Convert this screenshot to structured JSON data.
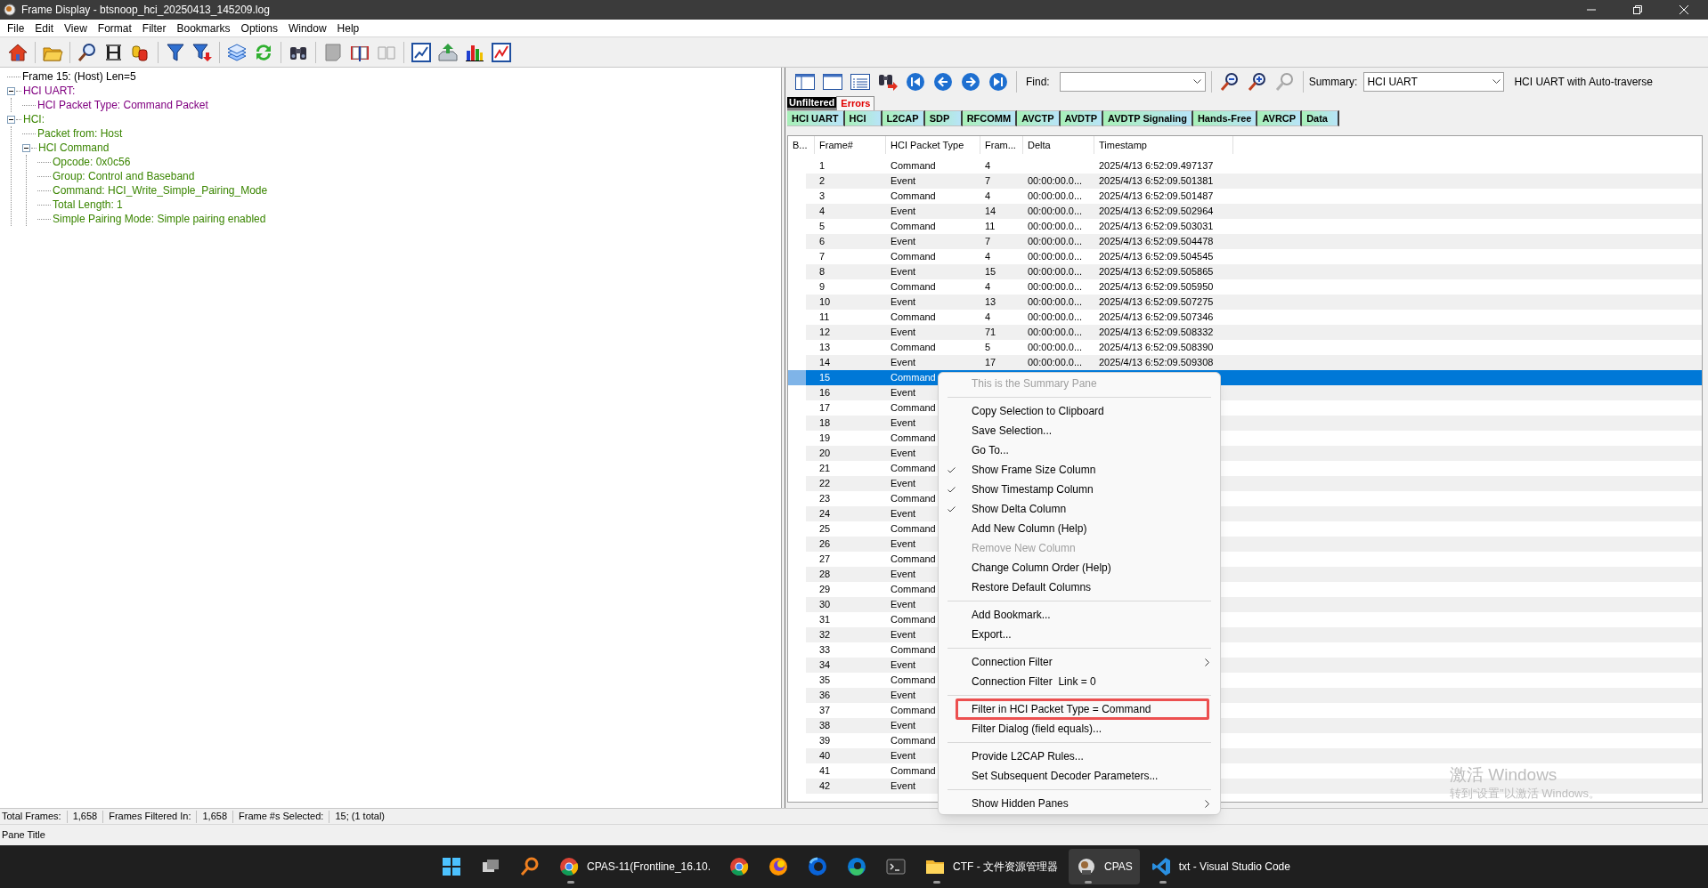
{
  "window": {
    "title": "Frame Display - btsnoop_hci_20250413_145209.log"
  },
  "menu": [
    "File",
    "Edit",
    "View",
    "Format",
    "Filter",
    "Bookmarks",
    "Options",
    "Window",
    "Help"
  ],
  "decode_tree": [
    {
      "label": "Frame 15: (Host) Len=5",
      "color": "#000000"
    },
    {
      "label": "HCI UART:",
      "color": "#800080",
      "expanded": true,
      "children": [
        {
          "label": "HCI Packet Type: Command Packet",
          "color": "#800080"
        }
      ]
    },
    {
      "label": "HCI:",
      "color": "#3a8500",
      "expanded": true,
      "children": [
        {
          "label": "Packet from: Host",
          "color": "#3a8500"
        },
        {
          "label": "HCI Command",
          "color": "#3a8500",
          "expanded": true,
          "children": [
            {
              "label": "Opcode: 0x0c56",
              "color": "#3a8500"
            },
            {
              "label": "Group: Control and Baseband",
              "color": "#3a8500"
            },
            {
              "label": "Command: HCI_Write_Simple_Pairing_Mode",
              "color": "#3a8500"
            },
            {
              "label": "Total Length: 1",
              "color": "#3a8500"
            },
            {
              "label": "Simple Pairing Mode: Simple pairing enabled",
              "color": "#3a8500"
            }
          ]
        }
      ]
    }
  ],
  "summary_toolbar": {
    "find_label": "Find:",
    "summary_label": "Summary:",
    "summary_value": "HCI UART",
    "mode": "HCI UART with Auto-traverse"
  },
  "filter_tabs": [
    {
      "label": "Unfiltered",
      "selected": true
    },
    {
      "label": "Errors",
      "selected": false
    }
  ],
  "protocol_tabs": [
    {
      "label": "HCI UART",
      "selected": false
    },
    {
      "label": "HCI",
      "selected": false
    },
    {
      "label": "L2CAP",
      "selected": false
    },
    {
      "label": "SDP",
      "selected": false
    },
    {
      "label": "RFCOMM",
      "selected": false
    },
    {
      "label": "AVCTP",
      "selected": false
    },
    {
      "label": "AVDTP",
      "selected": false
    },
    {
      "label": "AVDTP Signaling",
      "selected": false
    },
    {
      "label": "Hands-Free",
      "selected": false
    },
    {
      "label": "AVRCP",
      "selected": false
    },
    {
      "label": "Data",
      "selected": false
    }
  ],
  "table": {
    "columns": [
      "B...",
      "Frame#",
      "HCI Packet Type",
      "Fram...",
      "Delta",
      "Timestamp"
    ],
    "rows": [
      {
        "frame": "1",
        "type": "Command",
        "size": "4",
        "timestamp": "2025/4/13 6:52:09.497137",
        "selected": false
      },
      {
        "frame": "2",
        "type": "Event",
        "size": "7",
        "delta": "00:00:00.0...",
        "timestamp": "2025/4/13 6:52:09.501381",
        "selected": false
      },
      {
        "frame": "3",
        "type": "Command",
        "size": "4",
        "delta": "00:00:00.0...",
        "timestamp": "2025/4/13 6:52:09.501487",
        "selected": false
      },
      {
        "frame": "4",
        "type": "Event",
        "size": "14",
        "delta": "00:00:00.0...",
        "timestamp": "2025/4/13 6:52:09.502964",
        "selected": false
      },
      {
        "frame": "5",
        "type": "Command",
        "size": "11",
        "delta": "00:00:00.0...",
        "timestamp": "2025/4/13 6:52:09.503031",
        "selected": false
      },
      {
        "frame": "6",
        "type": "Event",
        "size": "7",
        "delta": "00:00:00.0...",
        "timestamp": "2025/4/13 6:52:09.504478",
        "selected": false
      },
      {
        "frame": "7",
        "type": "Command",
        "size": "4",
        "delta": "00:00:00.0...",
        "timestamp": "2025/4/13 6:52:09.504545",
        "selected": false
      },
      {
        "frame": "8",
        "type": "Event",
        "size": "15",
        "delta": "00:00:00.0...",
        "timestamp": "2025/4/13 6:52:09.505865",
        "selected": false
      },
      {
        "frame": "9",
        "type": "Command",
        "size": "4",
        "delta": "00:00:00.0...",
        "timestamp": "2025/4/13 6:52:09.505950",
        "selected": false
      },
      {
        "frame": "10",
        "type": "Event",
        "size": "13",
        "delta": "00:00:00.0...",
        "timestamp": "2025/4/13 6:52:09.507275",
        "selected": false
      },
      {
        "frame": "11",
        "type": "Command",
        "size": "4",
        "delta": "00:00:00.0...",
        "timestamp": "2025/4/13 6:52:09.507346",
        "selected": false
      },
      {
        "frame": "12",
        "type": "Event",
        "size": "71",
        "delta": "00:00:00.0...",
        "timestamp": "2025/4/13 6:52:09.508332",
        "selected": false
      },
      {
        "frame": "13",
        "type": "Command",
        "size": "5",
        "delta": "00:00:00.0...",
        "timestamp": "2025/4/13 6:52:09.508390",
        "selected": false
      },
      {
        "frame": "14",
        "type": "Event",
        "size": "17",
        "delta": "00:00:00.0...",
        "timestamp": "2025/4/13 6:52:09.509308",
        "selected": false
      },
      {
        "frame": "15",
        "type": "Command",
        "selected": true
      },
      {
        "frame": "16",
        "type": "Event",
        "selected": false
      },
      {
        "frame": "17",
        "type": "Command",
        "selected": false
      },
      {
        "frame": "18",
        "type": "Event",
        "selected": false
      },
      {
        "frame": "19",
        "type": "Command",
        "selected": false
      },
      {
        "frame": "20",
        "type": "Event",
        "selected": false
      },
      {
        "frame": "21",
        "type": "Command",
        "selected": false
      },
      {
        "frame": "22",
        "type": "Event",
        "selected": false
      },
      {
        "frame": "23",
        "type": "Command",
        "selected": false
      },
      {
        "frame": "24",
        "type": "Event",
        "selected": false
      },
      {
        "frame": "25",
        "type": "Command",
        "selected": false
      },
      {
        "frame": "26",
        "type": "Event",
        "selected": false
      },
      {
        "frame": "27",
        "type": "Command",
        "selected": false
      },
      {
        "frame": "28",
        "type": "Event",
        "selected": false
      },
      {
        "frame": "29",
        "type": "Command",
        "selected": false
      },
      {
        "frame": "30",
        "type": "Event",
        "selected": false
      },
      {
        "frame": "31",
        "type": "Command",
        "selected": false
      },
      {
        "frame": "32",
        "type": "Event",
        "selected": false
      },
      {
        "frame": "33",
        "type": "Command",
        "selected": false
      },
      {
        "frame": "34",
        "type": "Event",
        "selected": false
      },
      {
        "frame": "35",
        "type": "Command",
        "selected": false
      },
      {
        "frame": "36",
        "type": "Event",
        "selected": false
      },
      {
        "frame": "37",
        "type": "Command",
        "selected": false
      },
      {
        "frame": "38",
        "type": "Event",
        "selected": false
      },
      {
        "frame": "39",
        "type": "Command",
        "selected": false
      },
      {
        "frame": "40",
        "type": "Event",
        "selected": false
      },
      {
        "frame": "41",
        "type": "Command",
        "selected": false
      },
      {
        "frame": "42",
        "type": "Event",
        "selected": false
      }
    ]
  },
  "context_menu": {
    "items": [
      {
        "kind": "item",
        "label": "This is the Summary Pane",
        "disabled": true,
        "checked": false
      },
      {
        "kind": "separator"
      },
      {
        "kind": "item",
        "label": "Copy Selection to Clipboard",
        "disabled": false,
        "checked": false
      },
      {
        "kind": "item",
        "label": "Save Selection...",
        "disabled": false,
        "checked": false
      },
      {
        "kind": "item",
        "label": "Go To...",
        "disabled": false,
        "checked": false
      },
      {
        "kind": "item",
        "label": "Show Frame Size Column",
        "disabled": false,
        "checked": true
      },
      {
        "kind": "item",
        "label": "Show Timestamp Column",
        "disabled": false,
        "checked": true
      },
      {
        "kind": "item",
        "label": "Show Delta Column",
        "disabled": false,
        "checked": true
      },
      {
        "kind": "item",
        "label": "Add New Column (Help)",
        "disabled": false,
        "checked": false
      },
      {
        "kind": "item",
        "label": "Remove New Column",
        "disabled": true,
        "checked": false
      },
      {
        "kind": "item",
        "label": "Change Column Order (Help)",
        "disabled": false,
        "checked": false
      },
      {
        "kind": "item",
        "label": "Restore Default Columns",
        "disabled": false,
        "checked": false
      },
      {
        "kind": "separator"
      },
      {
        "kind": "item",
        "label": "Add Bookmark...",
        "disabled": false,
        "checked": false
      },
      {
        "kind": "item",
        "label": "Export...",
        "disabled": false,
        "checked": false
      },
      {
        "kind": "separator"
      },
      {
        "kind": "item",
        "label": "Connection Filter",
        "disabled": false,
        "checked": false,
        "submenu": true
      },
      {
        "kind": "item",
        "label": "Connection Filter  Link = 0",
        "disabled": false,
        "checked": false
      },
      {
        "kind": "separator"
      },
      {
        "kind": "item",
        "label": "Filter in HCI Packet Type = Command",
        "disabled": false,
        "checked": false,
        "annotated": true
      },
      {
        "kind": "item",
        "label": "Filter Dialog (field equals)...",
        "disabled": false,
        "checked": false
      },
      {
        "kind": "separator"
      },
      {
        "kind": "item",
        "label": "Provide L2CAP Rules...",
        "disabled": false,
        "checked": false
      },
      {
        "kind": "item",
        "label": "Set Subsequent Decoder Parameters...",
        "disabled": false,
        "checked": false
      },
      {
        "kind": "separator"
      },
      {
        "kind": "item",
        "label": "Show Hidden Panes",
        "disabled": false,
        "checked": false,
        "submenu": true
      }
    ]
  },
  "status_bar": [
    {
      "label": "Total Frames:",
      "value": "1,658"
    },
    {
      "label": "Frames Filtered In:",
      "value": "1,658"
    },
    {
      "label": "Frame #s Selected:",
      "value": "15; (1 total)"
    }
  ],
  "pane_title": "Pane Title",
  "activation_notice": {
    "title": "激活 Windows",
    "hint": "转到“设置”以激活 Windows。"
  },
  "taskbar": {
    "items": [
      {
        "kind": "start",
        "active": false
      },
      {
        "kind": "taskview",
        "active": false
      },
      {
        "kind": "search",
        "active": false
      },
      {
        "kind": "chrome",
        "label": "CPAS-11(Frontline_16.10.",
        "active": false
      },
      {
        "kind": "chrome",
        "active": false
      },
      {
        "kind": "firefox",
        "active": false
      },
      {
        "kind": "firefox-blue",
        "active": false
      },
      {
        "kind": "edge",
        "active": false
      },
      {
        "kind": "terminal",
        "active": false
      },
      {
        "kind": "folder",
        "label": "CTF - 文件资源管理器",
        "active": false
      },
      {
        "kind": "cpas",
        "label": "CPAS",
        "active": true
      },
      {
        "kind": "vscode",
        "label": "txt - Visual Studio Code",
        "active": false
      }
    ]
  }
}
